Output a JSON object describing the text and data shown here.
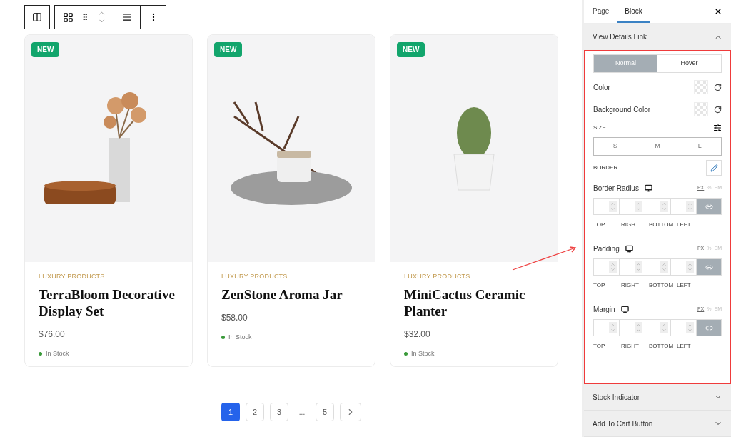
{
  "products": [
    {
      "badge": "NEW",
      "category": "LUXURY PRODUCTS",
      "name": "TerraBloom Decorative Display Set",
      "price": "$76.00",
      "stock": "In Stock",
      "kind": "pampas"
    },
    {
      "badge": "NEW",
      "category": "LUXURY PRODUCTS",
      "name": "ZenStone Aroma Jar",
      "price": "$58.00",
      "stock": "In Stock",
      "kind": "branch"
    },
    {
      "badge": "NEW",
      "category": "LUXURY PRODUCTS",
      "name": "MiniCactus Ceramic Planter",
      "price": "$32.00",
      "stock": "In Stock",
      "kind": "cactus"
    }
  ],
  "pagination": {
    "pages": [
      {
        "label": "1",
        "selected": true
      },
      {
        "label": "2",
        "selected": false
      },
      {
        "label": "3",
        "selected": false
      },
      {
        "label": "...",
        "kind": "ellipsis"
      },
      {
        "label": "5",
        "selected": false
      }
    ]
  },
  "sidebar": {
    "tabs": [
      {
        "label": "Page",
        "selected": false
      },
      {
        "label": "Block",
        "selected": true
      }
    ],
    "open_section": {
      "title": "View Details Link",
      "expanded": true,
      "states": [
        {
          "label": "Normal",
          "selected": true
        },
        {
          "label": "Hover",
          "selected": false
        }
      ],
      "colors": [
        {
          "label": "Color"
        },
        {
          "label": "Background Color"
        }
      ],
      "size": {
        "label": "SIZE",
        "options": [
          {
            "label": "S",
            "selected": false
          },
          {
            "label": "M",
            "selected": false
          },
          {
            "label": "L",
            "selected": false
          }
        ]
      },
      "border": {
        "label": "BORDER"
      },
      "spacing": [
        {
          "label": "Border Radius",
          "units": [
            {
              "label": "PX",
              "selected": true
            },
            {
              "label": "%",
              "selected": false
            },
            {
              "label": "EM",
              "selected": false
            }
          ],
          "sides": [
            "TOP",
            "RIGHT",
            "BOTTOM",
            "LEFT"
          ]
        },
        {
          "label": "Padding",
          "units": [
            {
              "label": "PX",
              "selected": true
            },
            {
              "label": "%",
              "selected": false
            },
            {
              "label": "EM",
              "selected": false
            }
          ],
          "sides": [
            "TOP",
            "RIGHT",
            "BOTTOM",
            "LEFT"
          ]
        },
        {
          "label": "Margin",
          "units": [
            {
              "label": "PX",
              "selected": true
            },
            {
              "label": "%",
              "selected": false
            },
            {
              "label": "EM",
              "selected": false
            }
          ],
          "sides": [
            "TOP",
            "RIGHT",
            "BOTTOM",
            "LEFT"
          ]
        }
      ]
    },
    "collapsed_sections": [
      {
        "title": "Stock Indicator",
        "expanded": false
      },
      {
        "title": "Add To Cart Button",
        "expanded": false
      }
    ]
  }
}
